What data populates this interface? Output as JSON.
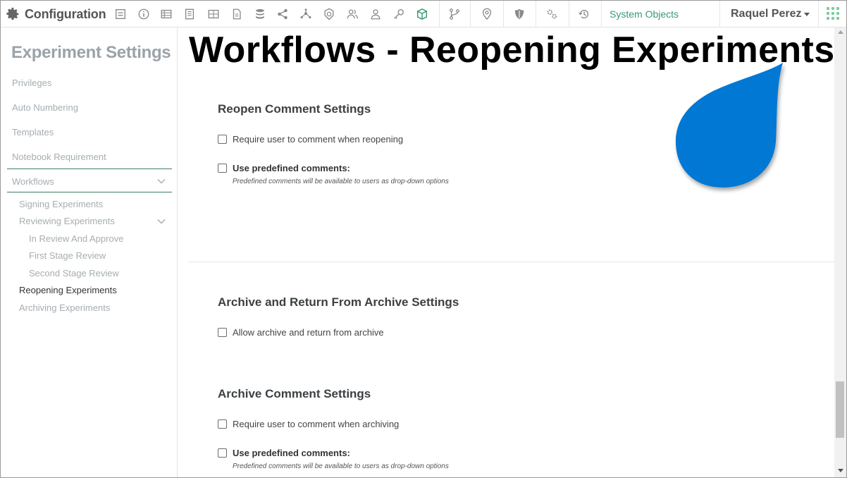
{
  "topbar": {
    "app_title": "Configuration",
    "icons": [
      "gear-icon",
      "form-icon",
      "info-icon",
      "table-icon",
      "notebook-icon",
      "grid-icon",
      "document-icon",
      "database-icon",
      "share-icon",
      "network-icon",
      "badge-icon",
      "users-icon",
      "user-icon",
      "key-icon",
      "cube-icon",
      "branch-icon",
      "location-icon",
      "shield-icon",
      "settings-icon",
      "history-icon"
    ],
    "system_objects": "System Objects",
    "user_name": "Raquel Perez",
    "accent_color": "#3a9a72"
  },
  "sidebar": {
    "title": "Experiment Settings",
    "items": [
      {
        "label": "Privileges"
      },
      {
        "label": "Auto Numbering"
      },
      {
        "label": "Templates"
      },
      {
        "label": "Notebook Requirement"
      },
      {
        "label": "Workflows"
      }
    ],
    "workflow_items": [
      {
        "label": "Signing Experiments"
      },
      {
        "label": "Reviewing Experiments"
      },
      {
        "label": "In Review And Approve"
      },
      {
        "label": "First Stage Review"
      },
      {
        "label": "Second Stage Review"
      },
      {
        "label": "Reopening Experiments"
      },
      {
        "label": "Archiving Experiments"
      }
    ]
  },
  "main": {
    "overlay_title": "Workflows - Reopening Experiments",
    "sections": [
      {
        "title": "Reopen Comment Settings",
        "options": [
          {
            "label": "Require user to comment when reopening",
            "checked": false
          },
          {
            "label": "Use predefined comments:",
            "checked": false,
            "hint": "Predefined comments will be available to users as drop-down options"
          }
        ]
      },
      {
        "title": "Archive and Return From Archive Settings",
        "options": [
          {
            "label": "Allow archive and return from archive",
            "checked": false
          }
        ]
      },
      {
        "title": "Archive Comment Settings",
        "options": [
          {
            "label": "Require user to comment when archiving",
            "checked": false
          },
          {
            "label": "Use predefined comments:",
            "checked": false,
            "hint": "Predefined comments will be available to users as drop-down options"
          }
        ]
      }
    ],
    "pointer_color": "#0078d4"
  }
}
